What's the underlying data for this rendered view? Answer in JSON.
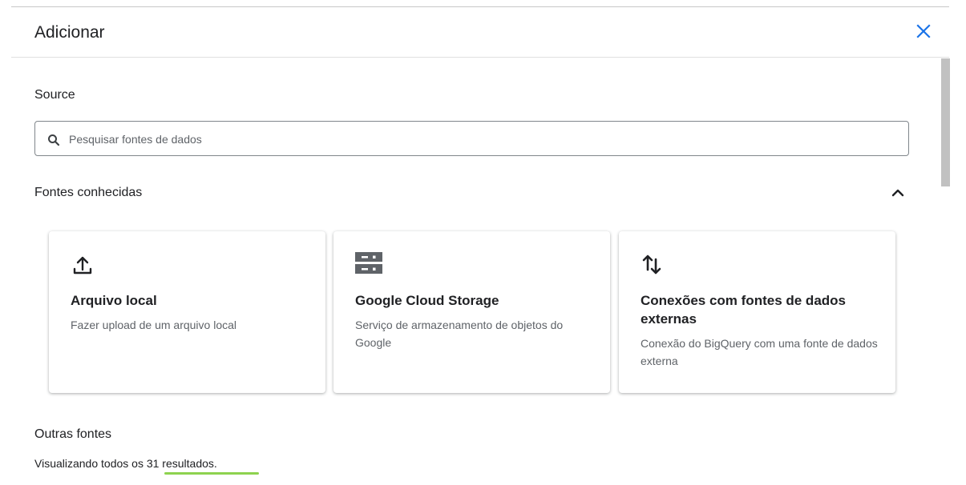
{
  "dialog": {
    "title": "Adicionar"
  },
  "source": {
    "label": "Source",
    "search_placeholder": "Pesquisar fontes de dados"
  },
  "known_sources": {
    "label": "Fontes conhecidas",
    "cards": [
      {
        "title": "Arquivo local",
        "description": "Fazer upload de um arquivo local",
        "icon": "upload-icon"
      },
      {
        "title": "Google Cloud Storage",
        "description": "Serviço de armazenamento de objetos do Google",
        "icon": "storage-icon"
      },
      {
        "title": "Conexões com fontes de dados externas",
        "description": "Conexão do BigQuery com uma fonte de dados externa",
        "icon": "swap-vert-icon"
      }
    ]
  },
  "other_sources": {
    "label": "Outras fontes",
    "results_text": "Visualizando todos os 31 resultados."
  },
  "colors": {
    "accent": "#1a73e8",
    "highlight": "#8ed24e"
  }
}
